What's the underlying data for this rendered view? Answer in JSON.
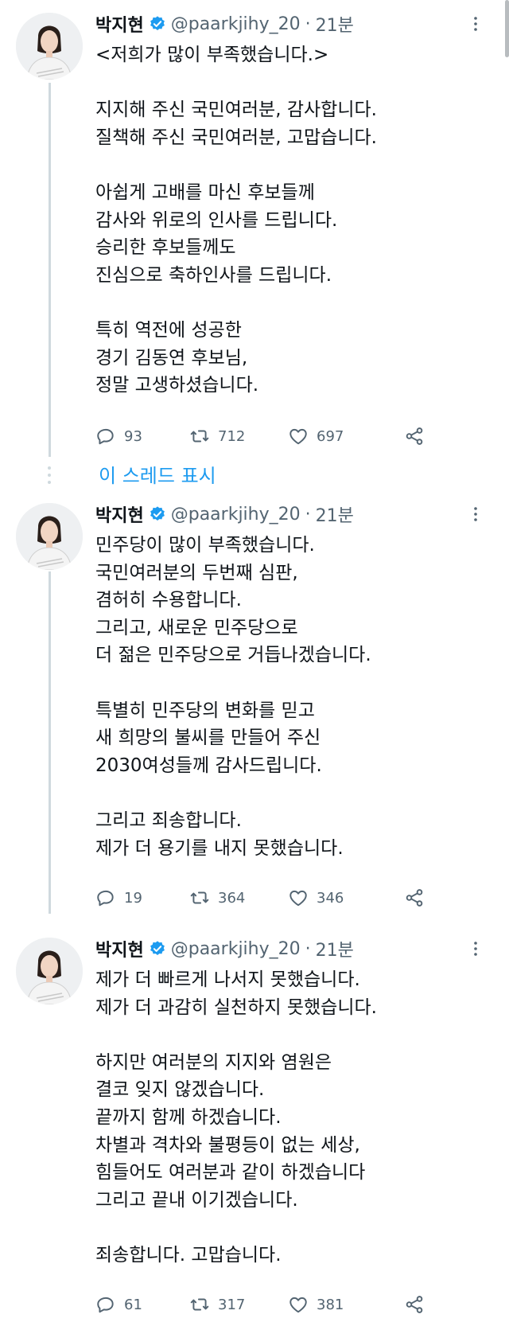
{
  "author": {
    "display_name": "박지현",
    "handle": "@paarkjihy_20",
    "separator": "·",
    "time": "21분"
  },
  "show_thread_label": "이 스레드 표시",
  "tweets": [
    {
      "lines": [
        "<저희가 많이 부족했습니다.>",
        "",
        "지지해 주신 국민여러분, 감사합니다.",
        "질책해 주신 국민여러분, 고맙습니다.",
        "",
        "아쉽게 고배를 마신 후보들께",
        "감사와 위로의 인사를 드립니다.",
        "승리한 후보들께도",
        "진심으로 축하인사를 드립니다.",
        "",
        "특히 역전에 성공한",
        "경기 김동연 후보님,",
        "정말 고생하셨습니다."
      ],
      "replies": "93",
      "retweets": "712",
      "likes": "697"
    },
    {
      "lines": [
        "민주당이 많이 부족했습니다.",
        "국민여러분의 두번째 심판,",
        "겸허히 수용합니다.",
        "그리고, 새로운 민주당으로",
        "더 젊은 민주당으로 거듭나겠습니다.",
        "",
        "특별히 민주당의 변화를 믿고",
        "새 희망의 불씨를 만들어 주신",
        "2030여성들께 감사드립니다.",
        "",
        "그리고 죄송합니다.",
        "제가 더 용기를 내지 못했습니다."
      ],
      "replies": "19",
      "retweets": "364",
      "likes": "346"
    },
    {
      "lines": [
        "제가 더 빠르게 나서지 못했습니다.",
        "제가 더 과감히 실천하지 못했습니다.",
        "",
        "하지만 여러분의 지지와 염원은",
        "결코 잊지 않겠습니다.",
        "끝까지 함께 하겠습니다.",
        "차별과 격차와 불평등이 없는 세상,",
        "힘들어도 여러분과 같이 하겠습니다",
        "그리고 끝내 이기겠습니다.",
        "",
        "죄송합니다. 고맙습니다."
      ],
      "replies": "61",
      "retweets": "317",
      "likes": "381"
    }
  ],
  "colors": {
    "text": "#0f1419",
    "secondary": "#536471",
    "accent": "#1d9bf0",
    "thread_line": "#cfd9de"
  },
  "icons": [
    "verified-badge-icon",
    "more-options-icon",
    "reply-icon",
    "retweet-icon",
    "like-icon",
    "share-icon"
  ]
}
